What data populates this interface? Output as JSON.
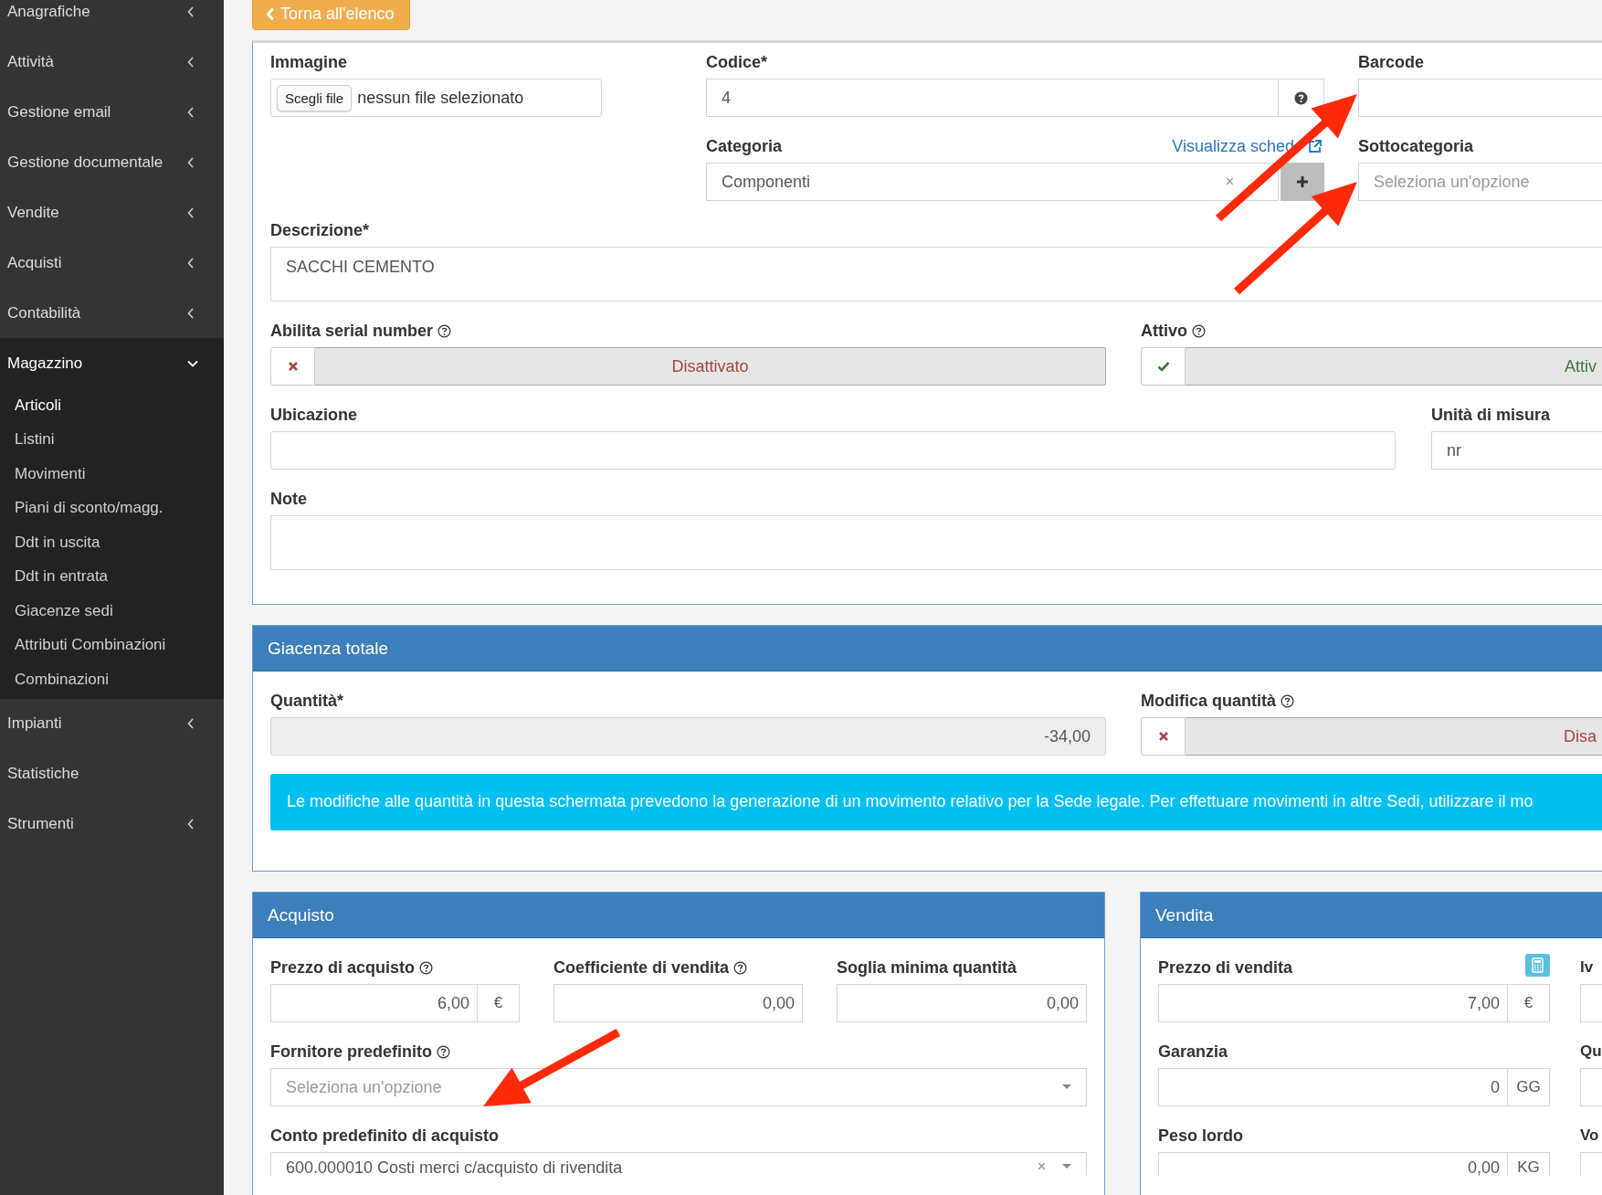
{
  "sidebar": {
    "items": [
      {
        "label": "Anagrafiche",
        "kind": "menu",
        "expanded": false
      },
      {
        "label": "Attività",
        "kind": "menu",
        "expanded": false
      },
      {
        "label": "Gestione email",
        "kind": "menu",
        "expanded": false
      },
      {
        "label": "Gestione documentale",
        "kind": "menu",
        "expanded": false
      },
      {
        "label": "Vendite",
        "kind": "menu",
        "expanded": false
      },
      {
        "label": "Acquisti",
        "kind": "menu",
        "expanded": false
      },
      {
        "label": "Contabilità",
        "kind": "menu",
        "expanded": false
      },
      {
        "label": "Magazzino",
        "kind": "menu",
        "expanded": true,
        "children": [
          {
            "label": "Articoli",
            "selected": true
          },
          {
            "label": "Listini",
            "selected": false
          },
          {
            "label": "Movimenti",
            "selected": false
          },
          {
            "label": "Piani di sconto/magg.",
            "selected": false
          },
          {
            "label": "Ddt in uscita",
            "selected": false
          },
          {
            "label": "Ddt in entrata",
            "selected": false
          },
          {
            "label": "Giacenze sedi",
            "selected": false
          },
          {
            "label": "Attributi Combinazioni",
            "selected": false
          },
          {
            "label": "Combinazioni",
            "selected": false
          }
        ]
      },
      {
        "label": "Impianti",
        "kind": "menu",
        "expanded": false
      },
      {
        "label": "Statistiche",
        "kind": "link",
        "expanded": false
      },
      {
        "label": "Strumenti",
        "kind": "menu",
        "expanded": false
      }
    ]
  },
  "back_button": {
    "label": "Torna all'elenco"
  },
  "details": {
    "image": {
      "label": "Immagine",
      "button": "Scegli file",
      "value": "nessun file selezionato"
    },
    "code": {
      "label": "Codice*",
      "value": "4"
    },
    "barcode": {
      "label": "Barcode"
    },
    "category": {
      "label": "Categoria",
      "link": "Visualizza sched",
      "value": "Componenti",
      "clear": "×"
    },
    "subcategory": {
      "label": "Sottocategoria",
      "placeholder": "Seleziona un'opzione"
    },
    "description": {
      "label": "Descrizione*",
      "value": "SACCHI CEMENTO"
    },
    "serial": {
      "label": "Abilita serial number",
      "help": true,
      "on": false,
      "state_text": "Disattivato"
    },
    "active": {
      "label": "Attivo",
      "help": true,
      "on": true,
      "state_text": "Attiv"
    },
    "location": {
      "label": "Ubicazione"
    },
    "unit": {
      "label": "Unità di misura",
      "value": "nr"
    },
    "notes": {
      "label": "Note"
    }
  },
  "stock": {
    "title": "Giacenza totale",
    "quantity": {
      "label": "Quantità*",
      "value": "-34,00"
    },
    "edit_quantity": {
      "label": "Modifica quantità",
      "help": true,
      "on": false,
      "state_text": "Disa"
    },
    "info": "Le modifiche alle quantità in questa schermata prevedono la generazione di un movimento relativo per la Sede legale. Per effettuare movimenti in altre Sedi, utilizzare il mo"
  },
  "purchase": {
    "title": "Acquisto",
    "price": {
      "label": "Prezzo di acquisto",
      "help": true,
      "value": "6,00",
      "unit": "€"
    },
    "coefficient": {
      "label": "Coefficiente di vendita",
      "help": true,
      "value": "0,00"
    },
    "min_qty": {
      "label": "Soglia minima quantità",
      "value": "0,00"
    },
    "supplier": {
      "label": "Fornitore predefinito",
      "help": true,
      "placeholder": "Seleziona un'opzione"
    },
    "account": {
      "label": "Conto predefinito di acquisto",
      "value": "600.000010 Costi merci c/acquisto di rivendita",
      "clear": "×"
    }
  },
  "sale": {
    "title": "Vendita",
    "price": {
      "label": "Prezzo di vendita",
      "value": "7,00",
      "unit": "€"
    },
    "warranty": {
      "label": "Garanzia",
      "value": "0",
      "unit": "GG"
    },
    "weight": {
      "label": "Peso lordo",
      "value": "0,00",
      "unit": "KG"
    },
    "column_2_labels": [
      "Iv",
      "Qu",
      "Vo"
    ]
  }
}
